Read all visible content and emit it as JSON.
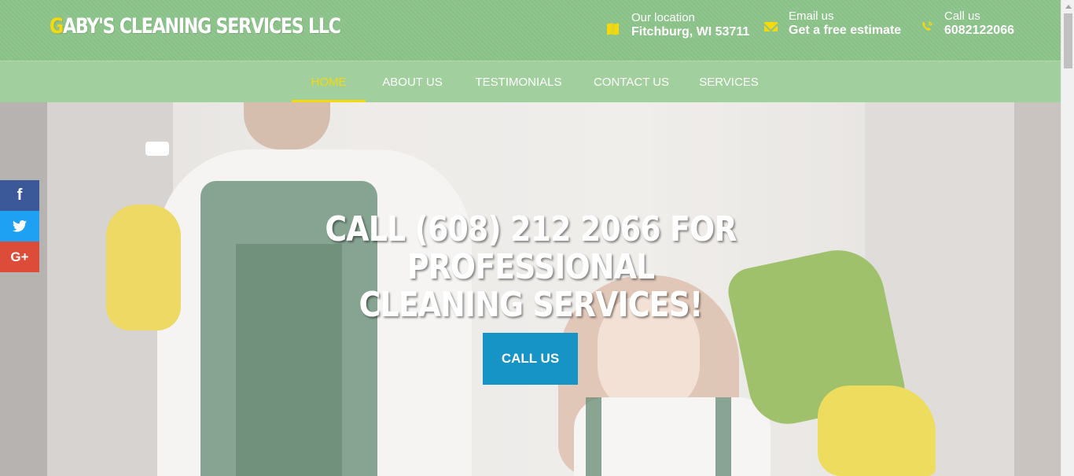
{
  "header": {
    "logo_first_letter": "G",
    "logo_rest": "ABY'S CLEANING SERVICES LLC",
    "location": {
      "label": "Our location",
      "value": "Fitchburg, WI 53711",
      "icon": "map-icon"
    },
    "email": {
      "label": "Email us",
      "value": "Get a free estimate",
      "icon": "envelope-icon"
    },
    "phone": {
      "label": "Call us",
      "value": "6082122066",
      "icon": "phone-icon"
    }
  },
  "nav": {
    "items": [
      {
        "label": "HOME",
        "active": true
      },
      {
        "label": "ABOUT US",
        "active": false
      },
      {
        "label": "TESTIMONIALS",
        "active": false
      },
      {
        "label": "CONTACT US",
        "active": false
      },
      {
        "label": "SERVICES",
        "active": false
      }
    ]
  },
  "hero": {
    "headline_line1": "CALL (608) 212 2066 FOR PROFESSIONAL",
    "headline_line2": "CLEANING SERVICES!",
    "cta_label": "CALL US"
  },
  "social": {
    "facebook": {
      "glyph": "f",
      "icon": "facebook-icon"
    },
    "twitter": {
      "glyph": "🐦",
      "icon": "twitter-icon"
    },
    "googleplus": {
      "glyph": "G+",
      "icon": "google-plus-icon"
    }
  },
  "colors": {
    "header_green": "#8cc48a",
    "nav_green": "#a1cf9d",
    "accent_yellow": "#f5d90a",
    "cta_blue": "#1694c6",
    "facebook": "#3b5998",
    "twitter": "#1ea1f2",
    "googleplus": "#dd4b39"
  }
}
